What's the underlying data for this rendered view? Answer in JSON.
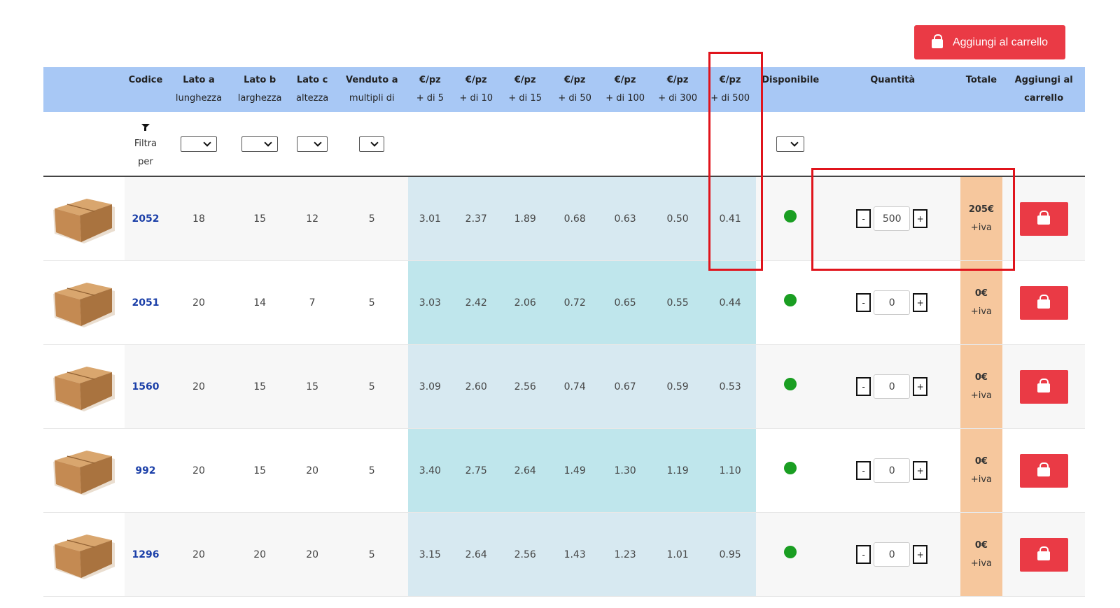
{
  "top_button": {
    "label": "Aggiungi al carrello",
    "icon": "shopping-bag-icon"
  },
  "columns": [
    {
      "name": "",
      "sub": ""
    },
    {
      "name": "Codice",
      "sub": ""
    },
    {
      "name": "Lato a",
      "sub": "lunghezza"
    },
    {
      "name": "Lato b",
      "sub": "larghezza"
    },
    {
      "name": "Lato c",
      "sub": "altezza"
    },
    {
      "name": "Venduto a",
      "sub": "multipli di"
    },
    {
      "name": "€/pz",
      "sub": "+ di 5"
    },
    {
      "name": "€/pz",
      "sub": "+ di 10"
    },
    {
      "name": "€/pz",
      "sub": "+ di 15"
    },
    {
      "name": "€/pz",
      "sub": "+ di 50"
    },
    {
      "name": "€/pz",
      "sub": "+ di 100"
    },
    {
      "name": "€/pz",
      "sub": "+ di 300"
    },
    {
      "name": "€/pz",
      "sub": "+ di 500"
    },
    {
      "name": "Disponibile",
      "sub": ""
    },
    {
      "name": "Quantità",
      "sub": ""
    },
    {
      "name": "Totale",
      "sub": ""
    },
    {
      "name": "Aggiungi al",
      "sub": "carrello"
    }
  ],
  "filter": {
    "label_line1": "Filtra",
    "label_line2": "per",
    "icon": "filter-icon"
  },
  "rows": [
    {
      "code": "2052",
      "a": "18",
      "b": "15",
      "c": "12",
      "multiple": "5",
      "prices": [
        "3.01",
        "2.37",
        "1.89",
        "0.68",
        "0.63",
        "0.50",
        "0.41"
      ],
      "qty": "500",
      "total": "205€",
      "vat": "+iva"
    },
    {
      "code": "2051",
      "a": "20",
      "b": "14",
      "c": "7",
      "multiple": "5",
      "prices": [
        "3.03",
        "2.42",
        "2.06",
        "0.72",
        "0.65",
        "0.55",
        "0.44"
      ],
      "qty": "0",
      "total": "0€",
      "vat": "+iva"
    },
    {
      "code": "1560",
      "a": "20",
      "b": "15",
      "c": "15",
      "multiple": "5",
      "prices": [
        "3.09",
        "2.60",
        "2.56",
        "0.74",
        "0.67",
        "0.59",
        "0.53"
      ],
      "qty": "0",
      "total": "0€",
      "vat": "+iva"
    },
    {
      "code": "992",
      "a": "20",
      "b": "15",
      "c": "20",
      "multiple": "5",
      "prices": [
        "3.40",
        "2.75",
        "2.64",
        "1.49",
        "1.30",
        "1.19",
        "1.10"
      ],
      "qty": "0",
      "total": "0€",
      "vat": "+iva"
    },
    {
      "code": "1296",
      "a": "20",
      "b": "20",
      "c": "20",
      "multiple": "5",
      "prices": [
        "3.15",
        "2.64",
        "2.56",
        "1.43",
        "1.23",
        "1.01",
        "0.95"
      ],
      "qty": "0",
      "total": "0€",
      "vat": "+iva"
    }
  ],
  "qty_minus": "-",
  "qty_plus": "+",
  "colors": {
    "accent_red": "#ea3a45",
    "header_blue": "#a8c8f5",
    "price_band": "#d7e9f1",
    "total_band": "#f6c79d",
    "available_green": "#1a9e22",
    "highlight_red": "#e0141c"
  }
}
